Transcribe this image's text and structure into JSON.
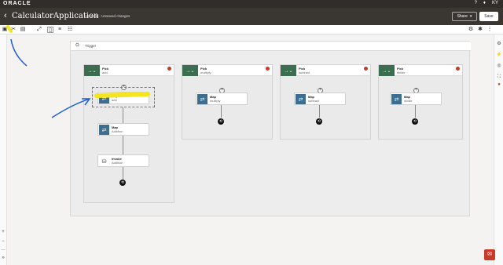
{
  "header": {
    "logo": "ORACLE",
    "user_initials": "KY"
  },
  "app": {
    "title": "CalculatorApplication",
    "status": "1.0 Draft - Unsaved changes",
    "share_label": "Share",
    "save_label": "Save"
  },
  "canvas": {
    "trigger_label": "Trigger"
  },
  "lanes": [
    {
      "title": "Pick",
      "subtitle": "add",
      "cards": [
        {
          "title": "Map",
          "subtitle": "add"
        },
        {
          "title": "Map",
          "subtitle": "Addition"
        },
        {
          "title": "Invoke",
          "subtitle": "Addition"
        }
      ]
    },
    {
      "title": "Pick",
      "subtitle": "multiply",
      "cards": [
        {
          "title": "Map",
          "subtitle": "multiply"
        }
      ]
    },
    {
      "title": "Pick",
      "subtitle": "subtract",
      "cards": [
        {
          "title": "Map",
          "subtitle": "subtract"
        }
      ]
    },
    {
      "title": "Pick",
      "subtitle": "divide",
      "cards": [
        {
          "title": "Map",
          "subtitle": "divide"
        }
      ]
    }
  ],
  "colors": {
    "pick": "#3b6e4f",
    "map": "#3b6e8f",
    "highlight": "#f5e51e",
    "annotation": "#1e5fd6",
    "error": "#c53b2a"
  }
}
